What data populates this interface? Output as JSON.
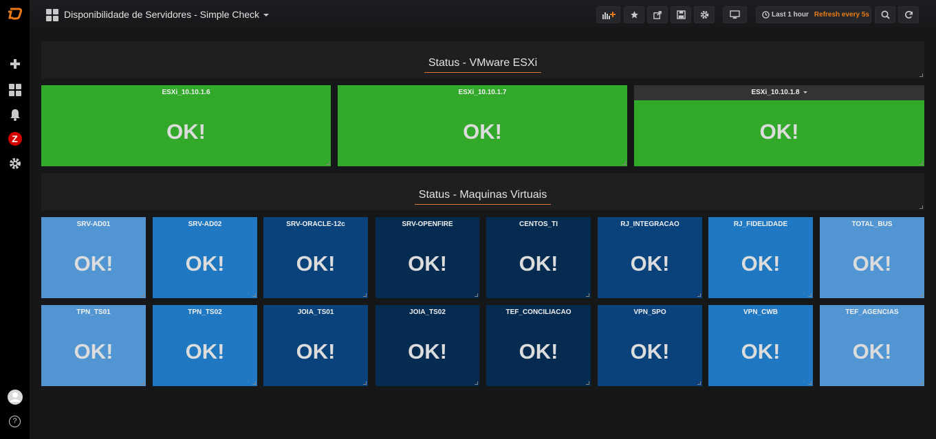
{
  "sidemenu": {
    "icons": [
      "grafana-logo-icon",
      "plus-icon",
      "dashboards-icon",
      "bell-icon",
      "zabbix-icon",
      "gear-icon",
      "avatar-icon",
      "help-icon"
    ],
    "zabbix_letter": "Z",
    "help_glyph": "?"
  },
  "navbar": {
    "title": "Disponibilidade de Servidores - Simple Check",
    "time_range": "Last 1 hour",
    "refresh": "Refresh every 5s",
    "accent_color": "#eb7b18"
  },
  "rows": [
    {
      "title": "Status - VMware ESXi",
      "panels": [
        {
          "title": "ESXi_10.10.1.6",
          "value": "OK!",
          "color": "#33a92b"
        },
        {
          "title": "ESXi_10.10.1.7",
          "value": "OK!",
          "color": "#33a92b"
        },
        {
          "title": "ESXi_10.10.1.8",
          "value": "OK!",
          "color": "#33a92b"
        }
      ]
    },
    {
      "title": "Status - Maquinas Virtuais",
      "panels": [
        {
          "title": "SRV-AD01",
          "value": "OK!",
          "color": "#5196d2"
        },
        {
          "title": "SRV-AD02",
          "value": "OK!",
          "color": "#1f78c1"
        },
        {
          "title": "SRV-ORACLE-12c",
          "value": "OK!",
          "color": "#0a437c"
        },
        {
          "title": "SRV-OPENFIRE",
          "value": "OK!",
          "color": "#052b51"
        },
        {
          "title": "CENTOS_TI",
          "value": "OK!",
          "color": "#052b51"
        },
        {
          "title": "RJ_INTEGRACAO",
          "value": "OK!",
          "color": "#0a437c"
        },
        {
          "title": "RJ_FIDELIDADE",
          "value": "OK!",
          "color": "#1f78c1"
        },
        {
          "title": "TOTAL_BUS",
          "value": "OK!",
          "color": "#5196d2"
        },
        {
          "title": "TPN_TS01",
          "value": "OK!",
          "color": "#5196d2"
        },
        {
          "title": "TPN_TS02",
          "value": "OK!",
          "color": "#1f78c1"
        },
        {
          "title": "JOIA_TS01",
          "value": "OK!",
          "color": "#0a437c"
        },
        {
          "title": "JOIA_TS02",
          "value": "OK!",
          "color": "#052b51"
        },
        {
          "title": "TEF_CONCILIACAO",
          "value": "OK!",
          "color": "#052b51"
        },
        {
          "title": "VPN_SPO",
          "value": "OK!",
          "color": "#0a437c"
        },
        {
          "title": "VPN_CWB",
          "value": "OK!",
          "color": "#1f78c1"
        },
        {
          "title": "TEF_AGENCIAS",
          "value": "OK!",
          "color": "#5196d2"
        }
      ]
    }
  ]
}
